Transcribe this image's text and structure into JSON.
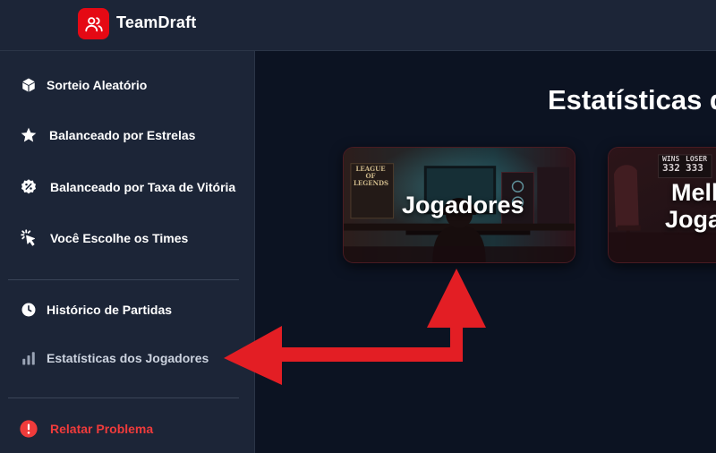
{
  "header": {
    "brand": "TeamDraft",
    "logo_icon": "users-icon",
    "brand_color": "#e50914"
  },
  "sidebar": {
    "items": [
      {
        "label": "Sorteio Aleatório",
        "icon": "cube-icon"
      },
      {
        "label": "Balanceado por Estrelas",
        "icon": "star-icon"
      },
      {
        "label": "Balanceado por Taxa de Vitória",
        "icon": "percent-badge-icon"
      },
      {
        "label": "Você Escolhe os Times",
        "icon": "click-cursor-icon"
      },
      {
        "label": "Histórico de Partidas",
        "icon": "clock-icon"
      },
      {
        "label": "Estatísticas dos Jogadores",
        "icon": "bar-chart-icon"
      },
      {
        "label": "Relatar Problema",
        "icon": "alert-circle-icon"
      }
    ]
  },
  "main": {
    "title": "Estatísticas d",
    "cards": [
      {
        "label": "Jogadores"
      },
      {
        "label_line1": "Mell",
        "label_line2": "Joga"
      }
    ],
    "poster_text": "LEAGUE OF LEGENDS",
    "scoreboard": {
      "left_label": "WINS",
      "right_label": "LOSER",
      "left_value": "332",
      "right_value": "333"
    }
  },
  "colors": {
    "accent": "#e50914",
    "danger": "#ef3b3b",
    "annotation_arrow": "#e31e24"
  }
}
